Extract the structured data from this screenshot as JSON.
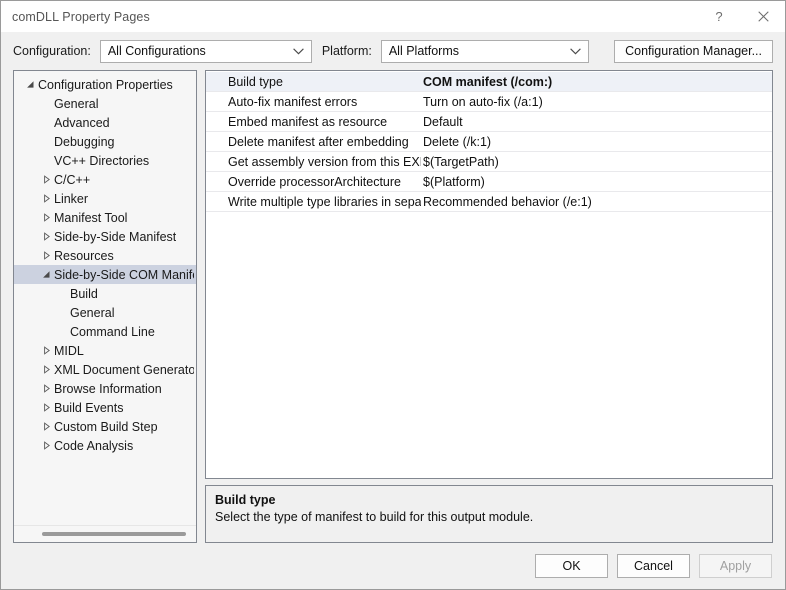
{
  "window": {
    "title": "comDLL Property Pages",
    "help_icon": "question-mark-icon",
    "close_icon": "close-icon"
  },
  "configbar": {
    "configuration_label": "Configuration:",
    "configuration_value": "All Configurations",
    "platform_label": "Platform:",
    "platform_value": "All Platforms",
    "configuration_manager_label": "Configuration Manager...",
    "dropdown_icon": "chevron-down-icon"
  },
  "tree": {
    "items": [
      {
        "label": "Configuration Properties",
        "indent": 0,
        "state": "expanded",
        "selected": false
      },
      {
        "label": "General",
        "indent": 1,
        "state": "leaf",
        "selected": false
      },
      {
        "label": "Advanced",
        "indent": 1,
        "state": "leaf",
        "selected": false
      },
      {
        "label": "Debugging",
        "indent": 1,
        "state": "leaf",
        "selected": false
      },
      {
        "label": "VC++ Directories",
        "indent": 1,
        "state": "leaf",
        "selected": false
      },
      {
        "label": "C/C++",
        "indent": 1,
        "state": "collapsed",
        "selected": false
      },
      {
        "label": "Linker",
        "indent": 1,
        "state": "collapsed",
        "selected": false
      },
      {
        "label": "Manifest Tool",
        "indent": 1,
        "state": "collapsed",
        "selected": false
      },
      {
        "label": "Side-by-Side Manifest",
        "indent": 1,
        "state": "collapsed",
        "selected": false
      },
      {
        "label": "Resources",
        "indent": 1,
        "state": "collapsed",
        "selected": false
      },
      {
        "label": "Side-by-Side COM Manifest",
        "indent": 1,
        "state": "expanded",
        "selected": true
      },
      {
        "label": "Build",
        "indent": 2,
        "state": "leaf",
        "selected": false
      },
      {
        "label": "General",
        "indent": 2,
        "state": "leaf",
        "selected": false
      },
      {
        "label": "Command Line",
        "indent": 2,
        "state": "leaf",
        "selected": false
      },
      {
        "label": "MIDL",
        "indent": 1,
        "state": "collapsed",
        "selected": false
      },
      {
        "label": "XML Document Generator",
        "indent": 1,
        "state": "collapsed",
        "selected": false
      },
      {
        "label": "Browse Information",
        "indent": 1,
        "state": "collapsed",
        "selected": false
      },
      {
        "label": "Build Events",
        "indent": 1,
        "state": "collapsed",
        "selected": false
      },
      {
        "label": "Custom Build Step",
        "indent": 1,
        "state": "collapsed",
        "selected": false
      },
      {
        "label": "Code Analysis",
        "indent": 1,
        "state": "collapsed",
        "selected": false
      }
    ],
    "scrollbar": "horizontal-scrollbar"
  },
  "grid": {
    "rows": [
      {
        "name": "Build type",
        "value": "COM manifest (/com:)",
        "selected": true
      },
      {
        "name": "Auto-fix manifest errors",
        "value": "Turn on auto-fix (/a:1)",
        "selected": false
      },
      {
        "name": "Embed manifest as resource",
        "value": "Default",
        "selected": false
      },
      {
        "name": "Delete manifest after embedding",
        "value": "Delete (/k:1)",
        "selected": false
      },
      {
        "name": "Get assembly version from this EXE or DLL",
        "value": "$(TargetPath)",
        "selected": false
      },
      {
        "name": "Override processorArchitecture",
        "value": "$(Platform)",
        "selected": false
      },
      {
        "name": "Write multiple type libraries in separate files",
        "value": "Recommended behavior (/e:1)",
        "selected": false
      }
    ]
  },
  "description": {
    "title": "Build type",
    "text": "Select the type of manifest to build for this output module."
  },
  "footer": {
    "ok_label": "OK",
    "cancel_label": "Cancel",
    "apply_label": "Apply",
    "apply_disabled": true
  },
  "colors": {
    "selection": "#ccd2e0",
    "row_selection": "#eef1f7",
    "border": "#828790",
    "dialog_bg": "#f0f0f0"
  }
}
